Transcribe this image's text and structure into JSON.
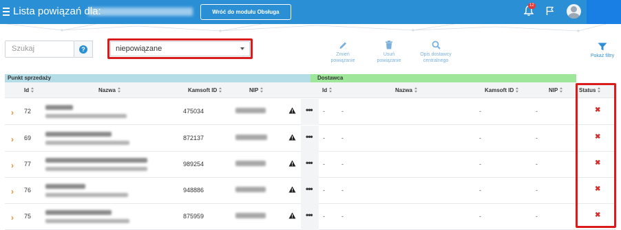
{
  "header": {
    "title": "Lista powiązań dla:",
    "back_button": "Wróć do modułu Obsługa powiązań",
    "notification_count": "12",
    "colors": {
      "bar": "#2b8fd6",
      "badge": "#e53935"
    }
  },
  "toolbar": {
    "search_placeholder": "Szukaj",
    "help_label": "?",
    "filter_value": "niepowiązane",
    "actions": [
      {
        "label": "Zmień powiązanie",
        "icon": "pencil-icon"
      },
      {
        "label": "Usuń powiązanie",
        "icon": "trash-icon"
      },
      {
        "label": "Opis dostawcy centralnego",
        "icon": "search-icon"
      }
    ],
    "filters_label": "Pokaż filtry"
  },
  "table": {
    "group_point": "Punkt sprzedaży",
    "group_supplier": "Dostawca",
    "columns": {
      "id": "Id",
      "name": "Nazwa",
      "kamsoft": "Kamsoft ID",
      "nip": "NIP",
      "supplier_id": "Id",
      "supplier_name": "Nazwa",
      "supplier_kamsoft": "Kamsoft ID",
      "supplier_nip": "NIP",
      "status": "Status"
    },
    "rows": [
      {
        "id": "72",
        "kamsoft": "475034",
        "more": "•••",
        "dash": "-",
        "status": "✖"
      },
      {
        "id": "69",
        "kamsoft": "872137",
        "more": "•••",
        "dash": "-",
        "status": "✖"
      },
      {
        "id": "77",
        "kamsoft": "989254",
        "more": "•••",
        "dash": "-",
        "status": "✖"
      },
      {
        "id": "76",
        "kamsoft": "948886",
        "more": "•••",
        "dash": "-",
        "status": "✖"
      },
      {
        "id": "75",
        "kamsoft": "875959",
        "more": "•••",
        "dash": "-",
        "status": "✖"
      }
    ],
    "colors": {
      "group_point": "#b4dde8",
      "group_supplier": "#9de69a",
      "chevron": "#f08c2d",
      "status_x": "#d32f2f",
      "highlight": "#d91b1b"
    }
  }
}
